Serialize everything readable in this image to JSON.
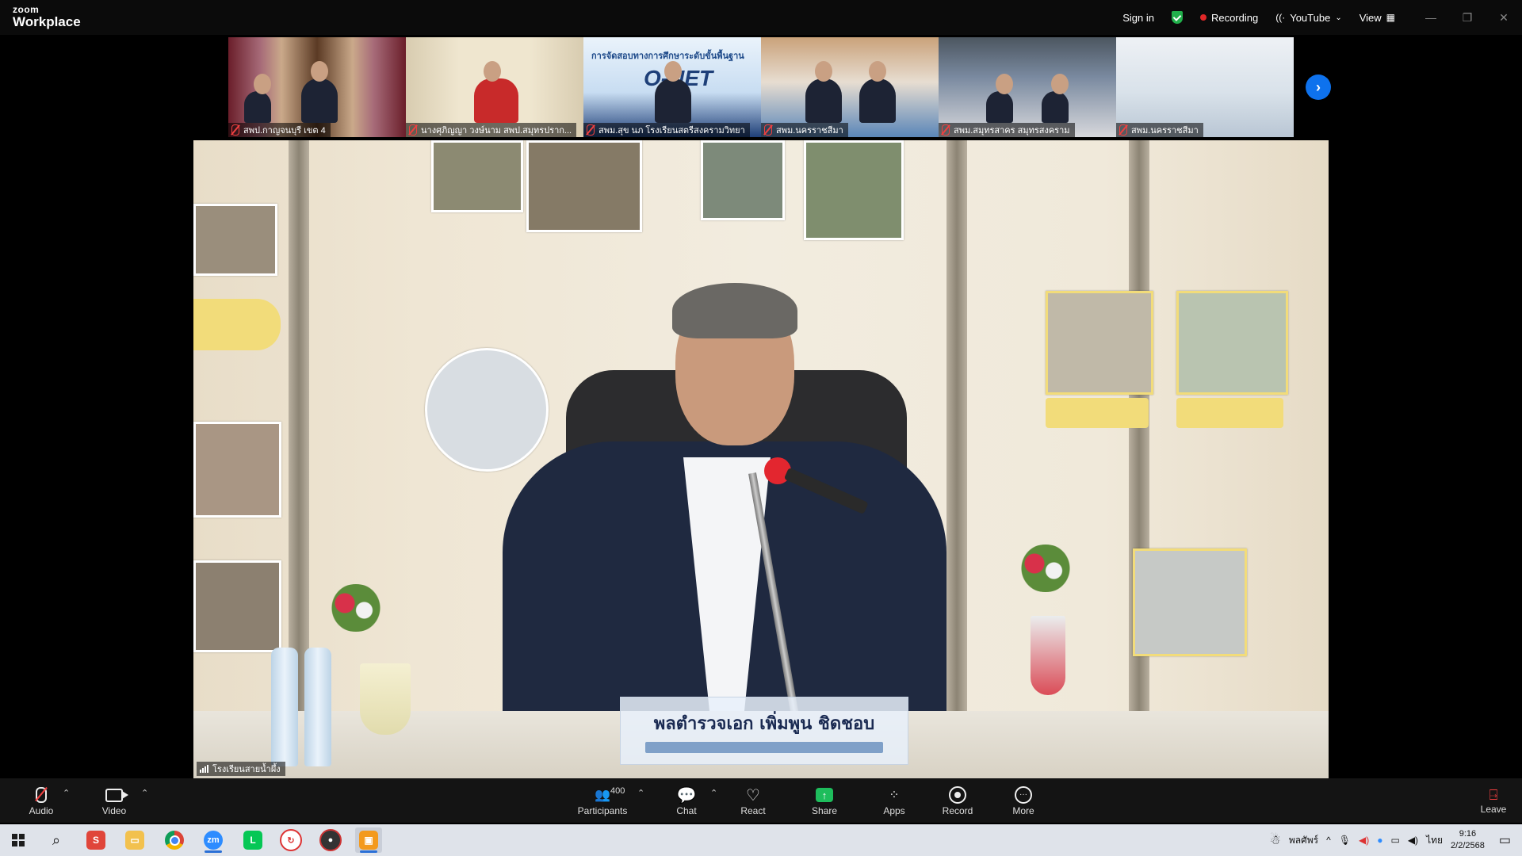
{
  "app": {
    "brand_small": "zoom",
    "brand_large": "Workplace"
  },
  "titlebar": {
    "sign_in": "Sign in",
    "recording": "Recording",
    "stream": "YouTube",
    "view": "View"
  },
  "gallery": {
    "tiles": [
      {
        "name": "สพป.กาญจนบุรี เขต 4"
      },
      {
        "name": "นางศุภิญญา วงษ์นาม สพป.สมุทรปราก..."
      },
      {
        "name": "สพม.สุข นภ โรงเรียนสตรีสงครามวิทยา"
      },
      {
        "name": "สพม.นครราชสีมา"
      },
      {
        "name": "สพม.สมุทรสาคร สมุทรสงคราม"
      },
      {
        "name": "สพม.นครราชสีมา"
      }
    ],
    "tile3_slide_title": "การจัดสอบทางการศึกษาระดับขั้นพื้นฐาน",
    "tile3_slide_big": "O-NET"
  },
  "main": {
    "nameplate": "พลตำรวจเอก เพิ่มพูน ชิดชอบ",
    "participant_label": "โรงเรียนสายน้ำผึ้ง"
  },
  "controls": {
    "audio": "Audio",
    "video": "Video",
    "participants": "Participants",
    "participants_count": "400",
    "chat": "Chat",
    "react": "React",
    "share": "Share",
    "apps": "Apps",
    "record": "Record",
    "more": "More",
    "leave": "Leave"
  },
  "taskbar": {
    "language": "พลศัพร์",
    "ime": "ไทย",
    "time": "9:16",
    "date": "2/2/2568"
  },
  "colors": {
    "accent": "#0e72ed",
    "share_green": "#1ebd5c",
    "recording_red": "#e02828",
    "security_green": "#21b04b"
  }
}
